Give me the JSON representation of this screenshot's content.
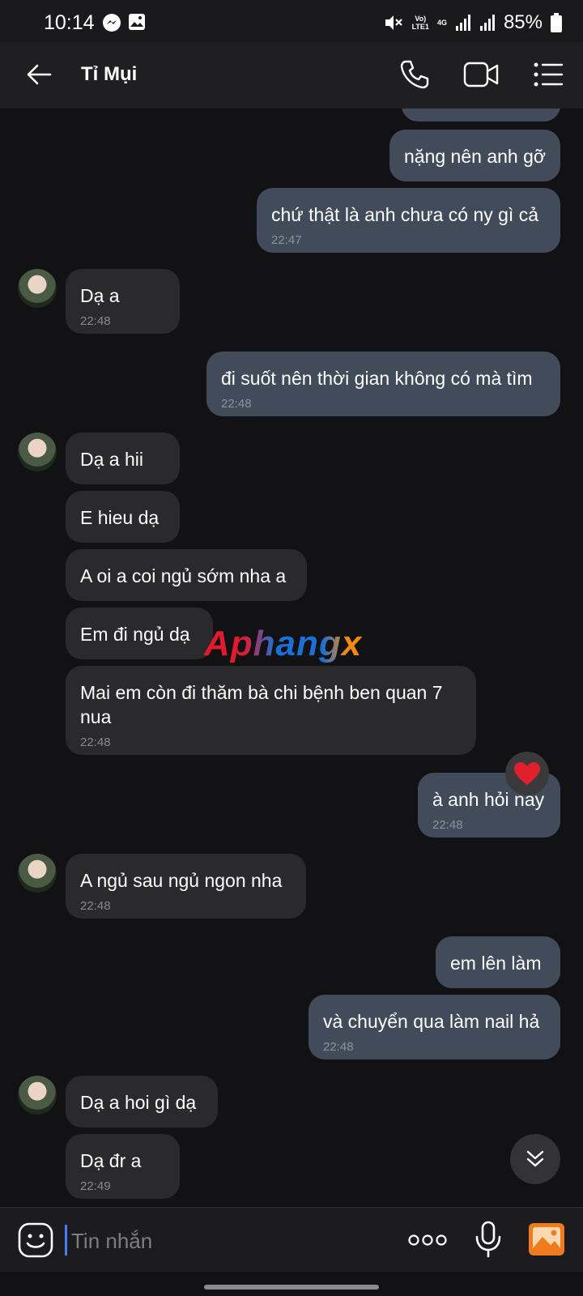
{
  "status_bar": {
    "time": "10:14",
    "battery": "85%",
    "volte": "Vo)\nLTE1",
    "network": "4G"
  },
  "header": {
    "contact_name": "Tỉ Mụi"
  },
  "messages": [
    {
      "dir": "sent",
      "text": "nặng nên anh gỡ",
      "time": ""
    },
    {
      "dir": "sent",
      "text": "chứ thật là anh chưa có ny gì cả",
      "time": "22:47"
    },
    {
      "dir": "recv",
      "text": "Dạ a",
      "time": "22:48"
    },
    {
      "dir": "sent",
      "text": "đi suốt nên thời gian không có mà tìm",
      "time": "22:48"
    },
    {
      "dir": "recv",
      "text": "Dạ a hii",
      "time": ""
    },
    {
      "dir": "recv",
      "text": "E hieu dạ",
      "time": ""
    },
    {
      "dir": "recv",
      "text": "A oi a coi ngủ sớm nha a",
      "time": ""
    },
    {
      "dir": "recv",
      "text": "Em đi ngủ dạ",
      "time": ""
    },
    {
      "dir": "recv",
      "text": "Mai em còn đi thăm bà chi bệnh ben quan 7 nua",
      "time": "22:48"
    },
    {
      "dir": "sent",
      "text": "à anh hỏi nay",
      "time": "22:48"
    },
    {
      "dir": "recv",
      "text": "A ngủ sau ngủ ngon nha",
      "time": "22:48"
    },
    {
      "dir": "sent",
      "text": "em lên làm",
      "time": ""
    },
    {
      "dir": "sent",
      "text": "và chuyển qua làm nail hả",
      "time": "22:48"
    },
    {
      "dir": "recv",
      "text": "Dạ a hoi gì dạ",
      "time": ""
    },
    {
      "dir": "recv",
      "text": "Dạ đr a",
      "time": "22:49"
    }
  ],
  "watermark": "Aphangx",
  "composer": {
    "placeholder": "Tin nhắn"
  },
  "icons": {
    "back": "back-arrow-icon",
    "call": "phone-icon",
    "video": "video-camera-icon",
    "menu": "list-menu-icon",
    "emoji": "emoji-icon",
    "more": "more-dots-icon",
    "mic": "microphone-icon",
    "gallery": "gallery-icon",
    "reaction": "heart-icon",
    "scroll": "double-chevron-down-icon"
  },
  "colors": {
    "sent_bubble": "#414b5a",
    "received_bubble": "#2a2a2c",
    "background": "#121214",
    "caret": "#4a7cf5",
    "gallery_accent": "#f07a1e"
  }
}
